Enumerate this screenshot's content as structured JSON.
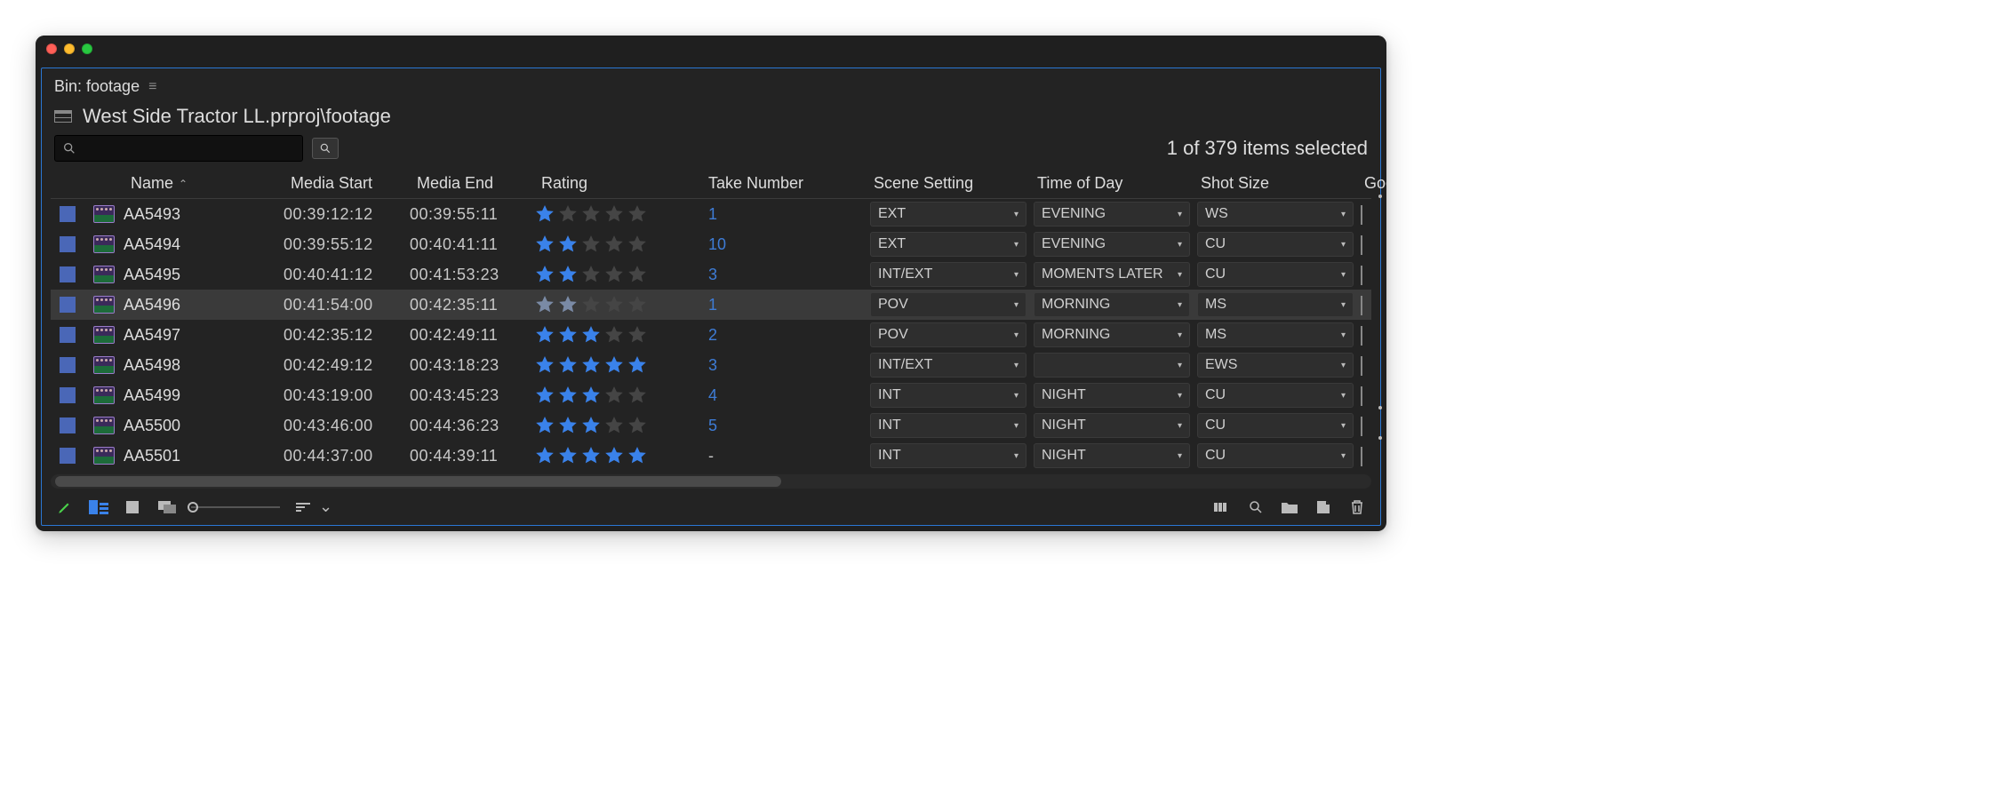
{
  "window": {
    "tab_label": "Bin: footage"
  },
  "breadcrumb": {
    "path": "West Side Tractor LL.prproj\\footage"
  },
  "status": {
    "selection": "1 of 379 items selected"
  },
  "columns": [
    {
      "key": "sel",
      "label": ""
    },
    {
      "key": "icon",
      "label": ""
    },
    {
      "key": "name",
      "label": "Name",
      "sorted": "asc"
    },
    {
      "key": "mstart",
      "label": "Media Start"
    },
    {
      "key": "mend",
      "label": "Media End"
    },
    {
      "key": "rating",
      "label": "Rating"
    },
    {
      "key": "take",
      "label": "Take Number"
    },
    {
      "key": "scene",
      "label": "Scene Setting"
    },
    {
      "key": "tod",
      "label": "Time of Day"
    },
    {
      "key": "shot",
      "label": "Shot Size"
    },
    {
      "key": "good",
      "label": "Goo"
    }
  ],
  "rows": [
    {
      "name": "AA5493",
      "mstart": "00:39:12:12",
      "mend": "00:39:55:11",
      "rating": 1,
      "take": "1",
      "scene": "EXT",
      "tod": "EVENING",
      "shot": "WS",
      "good_dot": true,
      "selected": false
    },
    {
      "name": "AA5494",
      "mstart": "00:39:55:12",
      "mend": "00:40:41:11",
      "rating": 2,
      "take": "10",
      "scene": "EXT",
      "tod": "EVENING",
      "shot": "CU",
      "good_dot": false,
      "selected": false
    },
    {
      "name": "AA5495",
      "mstart": "00:40:41:12",
      "mend": "00:41:53:23",
      "rating": 2,
      "take": "3",
      "scene": "INT/EXT",
      "tod": "MOMENTS LATER",
      "shot": "CU",
      "good_dot": false,
      "selected": false
    },
    {
      "name": "AA5496",
      "mstart": "00:41:54:00",
      "mend": "00:42:35:11",
      "rating": 2,
      "take": "1",
      "scene": "POV",
      "tod": "MORNING",
      "shot": "MS",
      "good_dot": false,
      "selected": true
    },
    {
      "name": "AA5497",
      "mstart": "00:42:35:12",
      "mend": "00:42:49:11",
      "rating": 3,
      "take": "2",
      "scene": "POV",
      "tod": "MORNING",
      "shot": "MS",
      "good_dot": false,
      "selected": false
    },
    {
      "name": "AA5498",
      "mstart": "00:42:49:12",
      "mend": "00:43:18:23",
      "rating": 5,
      "take": "3",
      "scene": "INT/EXT",
      "tod": "",
      "shot": "EWS",
      "good_dot": false,
      "selected": false
    },
    {
      "name": "AA5499",
      "mstart": "00:43:19:00",
      "mend": "00:43:45:23",
      "rating": 3,
      "take": "4",
      "scene": "INT",
      "tod": "NIGHT",
      "shot": "CU",
      "good_dot": false,
      "selected": false
    },
    {
      "name": "AA5500",
      "mstart": "00:43:46:00",
      "mend": "00:44:36:23",
      "rating": 3,
      "take": "5",
      "scene": "INT",
      "tod": "NIGHT",
      "shot": "CU",
      "good_dot": true,
      "selected": false
    },
    {
      "name": "AA5501",
      "mstart": "00:44:37:00",
      "mend": "00:44:39:11",
      "rating": 5,
      "take": "-",
      "scene": "INT",
      "tod": "NIGHT",
      "shot": "CU",
      "good_dot": true,
      "selected": false
    }
  ]
}
